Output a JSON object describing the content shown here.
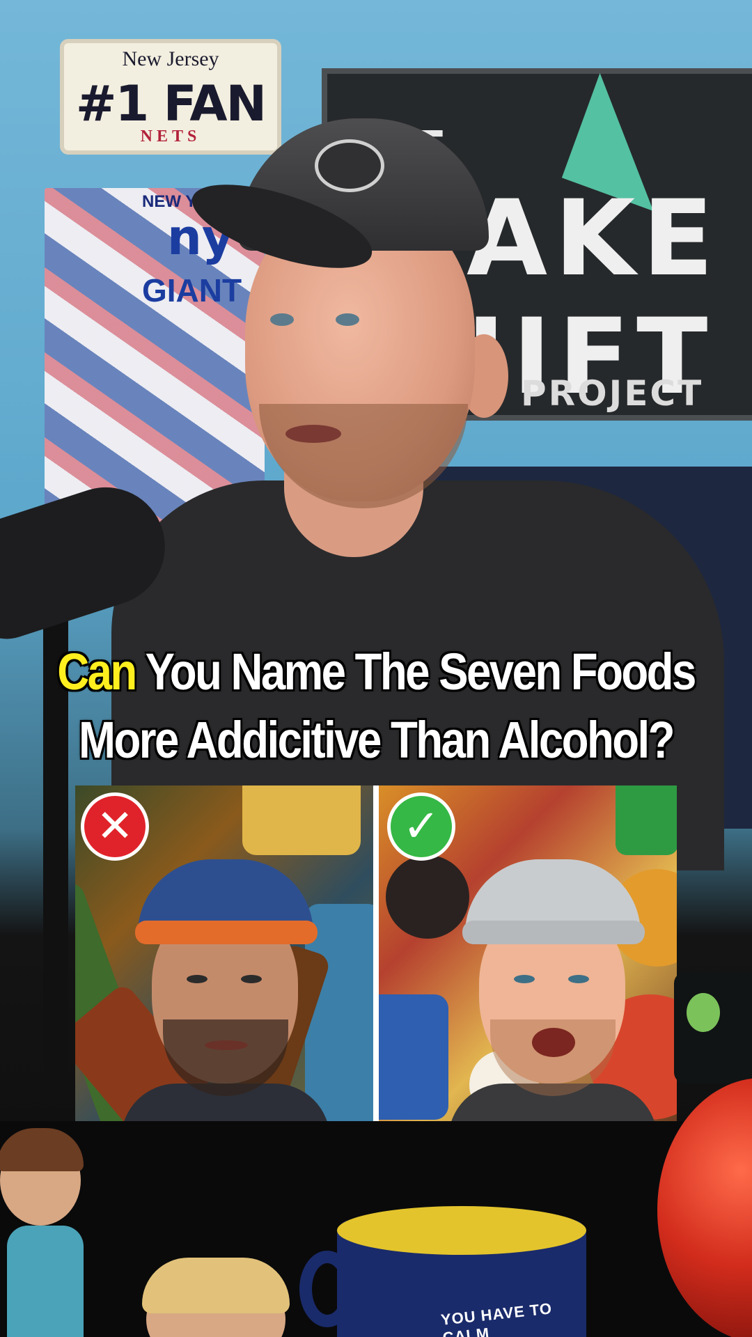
{
  "video": {
    "caption": {
      "highlight": "Can",
      "line1_rest": " You Name The Seven Foods",
      "line2": "More Addicitive Than Alcohol?"
    },
    "comparison": {
      "left_badge": "✕",
      "right_badge": "✓"
    }
  },
  "background": {
    "plate": {
      "state": "New Jersey",
      "main": "#1 FAN",
      "team": "NETS"
    },
    "poster": {
      "top": "NEW YO",
      "logo": "ny",
      "name": "GIANT"
    },
    "sign": {
      "line1": "THE",
      "line2": "AKE",
      "line3": "IIFT",
      "line4": "PROJECT"
    },
    "mug_text": "YOU HAVE TO CALM"
  },
  "colors": {
    "caption_text": "#ffffff",
    "caption_highlight": "#ffef1f",
    "bad_badge": "#e0232a",
    "good_badge": "#35b845"
  }
}
